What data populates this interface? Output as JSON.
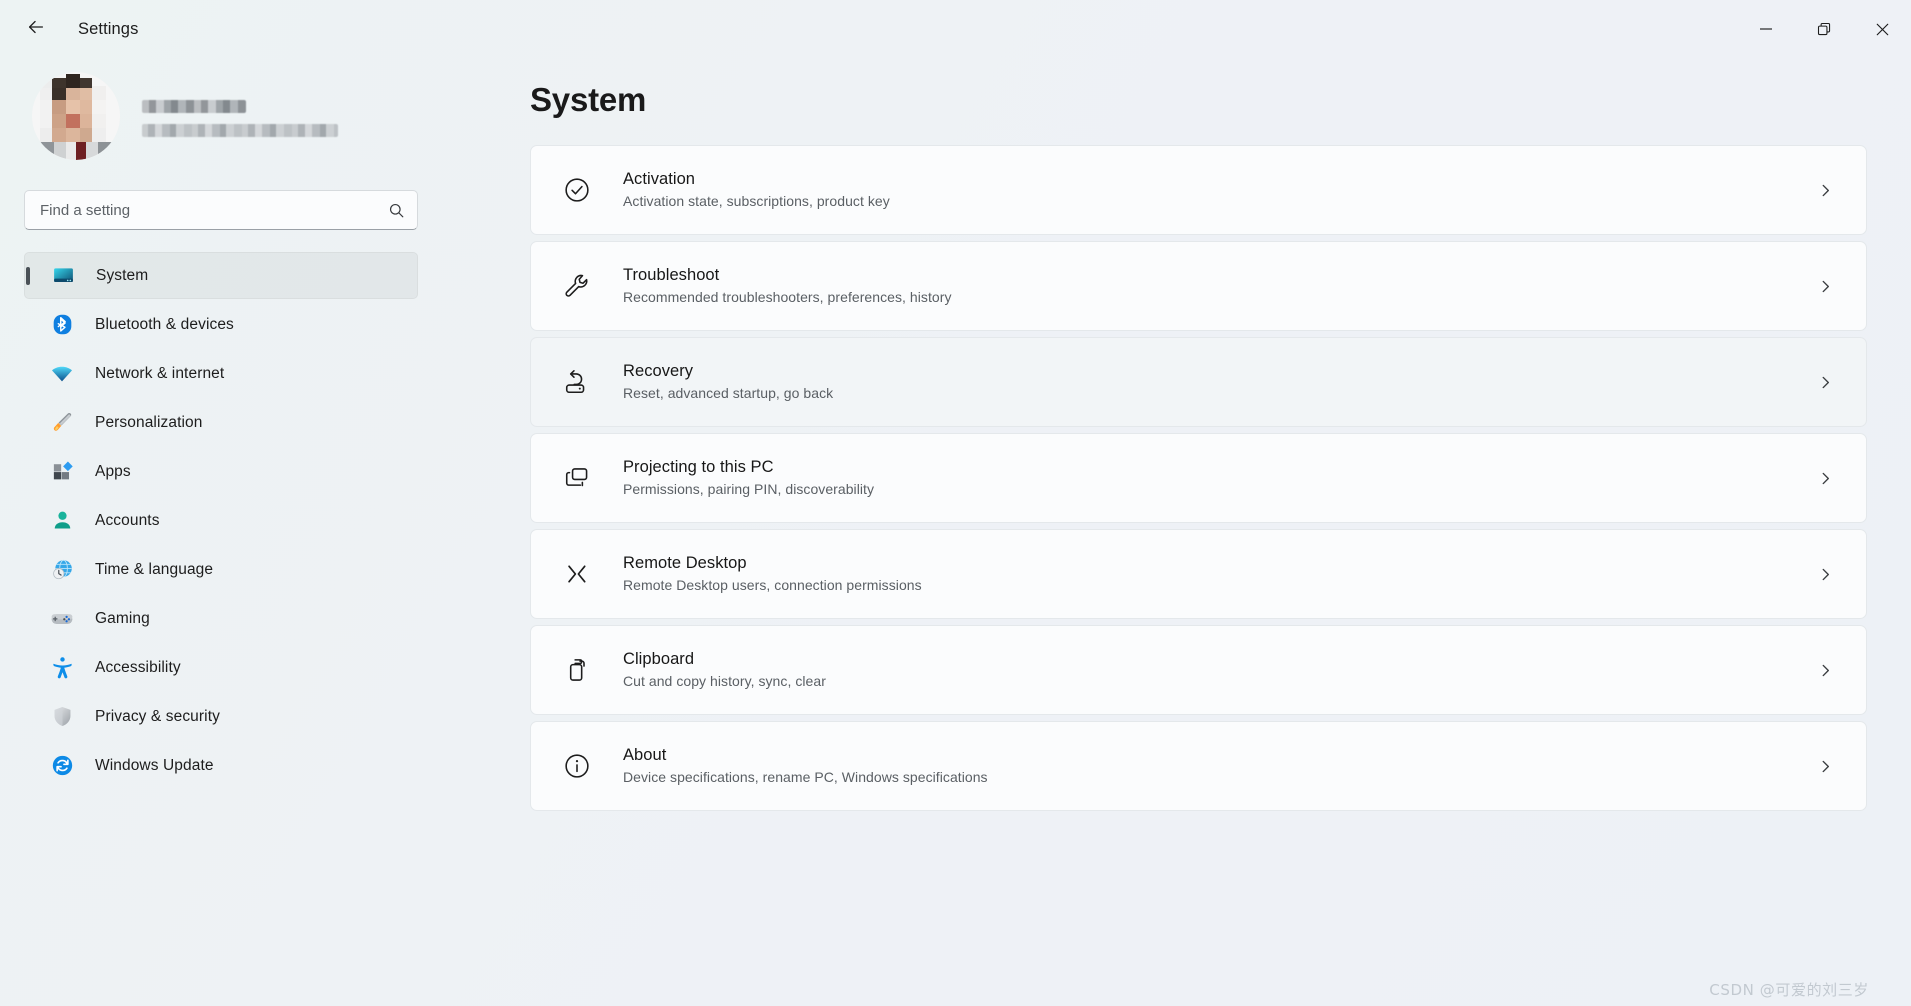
{
  "window": {
    "title": "Settings",
    "back_icon": "back-arrow-icon",
    "controls": {
      "minimize": "minimize-icon",
      "maximize": "restore-icon",
      "close": "close-icon"
    }
  },
  "sidebar": {
    "account": {
      "avatar": "user-avatar",
      "name": "",
      "email": ""
    },
    "search": {
      "placeholder": "Find a setting",
      "value": "",
      "icon": "search-icon"
    },
    "items": [
      {
        "label": "System",
        "icon": "monitor-icon",
        "selected": true
      },
      {
        "label": "Bluetooth & devices",
        "icon": "bluetooth-icon",
        "selected": false
      },
      {
        "label": "Network & internet",
        "icon": "wifi-icon",
        "selected": false
      },
      {
        "label": "Personalization",
        "icon": "paintbrush-icon",
        "selected": false
      },
      {
        "label": "Apps",
        "icon": "apps-grid-icon",
        "selected": false
      },
      {
        "label": "Accounts",
        "icon": "person-icon",
        "selected": false
      },
      {
        "label": "Time & language",
        "icon": "globe-clock-icon",
        "selected": false
      },
      {
        "label": "Gaming",
        "icon": "gamepad-icon",
        "selected": false
      },
      {
        "label": "Accessibility",
        "icon": "accessibility-icon",
        "selected": false
      },
      {
        "label": "Privacy & security",
        "icon": "shield-icon",
        "selected": false
      },
      {
        "label": "Windows Update",
        "icon": "sync-refresh-icon",
        "selected": false
      }
    ]
  },
  "main": {
    "title": "System",
    "cards": [
      {
        "title": "Activation",
        "subtitle": "Activation state, subscriptions, product key",
        "icon": "check-circle-icon",
        "hover": false
      },
      {
        "title": "Troubleshoot",
        "subtitle": "Recommended troubleshooters, preferences, history",
        "icon": "wrench-icon",
        "hover": false
      },
      {
        "title": "Recovery",
        "subtitle": "Reset, advanced startup, go back",
        "icon": "recovery-drive-icon",
        "hover": true
      },
      {
        "title": "Projecting to this PC",
        "subtitle": "Permissions, pairing PIN, discoverability",
        "icon": "project-screen-icon",
        "hover": false
      },
      {
        "title": "Remote Desktop",
        "subtitle": "Remote Desktop users, connection permissions",
        "icon": "remote-desktop-icon",
        "hover": false
      },
      {
        "title": "Clipboard",
        "subtitle": "Cut and copy history, sync, clear",
        "icon": "clipboard-icon",
        "hover": false
      },
      {
        "title": "About",
        "subtitle": "Device specifications, rename PC, Windows specifications",
        "icon": "info-circle-icon",
        "hover": false
      }
    ],
    "chevron_icon": "chevron-right-icon"
  },
  "watermark": {
    "text": "CSDN @可爱的刘三岁"
  },
  "colors": {
    "background": "#eef2f5",
    "card": "#fbfcfd",
    "card_border": "#e4e8eb",
    "accent_bar": "#4a5157",
    "title_text": "#1a1a1a",
    "subtitle_text": "#5a5f64",
    "bluetooth_blue": "#0f7fe0",
    "accessibility_blue": "#0e8ee9",
    "update_blue": "#0d8ae6"
  }
}
